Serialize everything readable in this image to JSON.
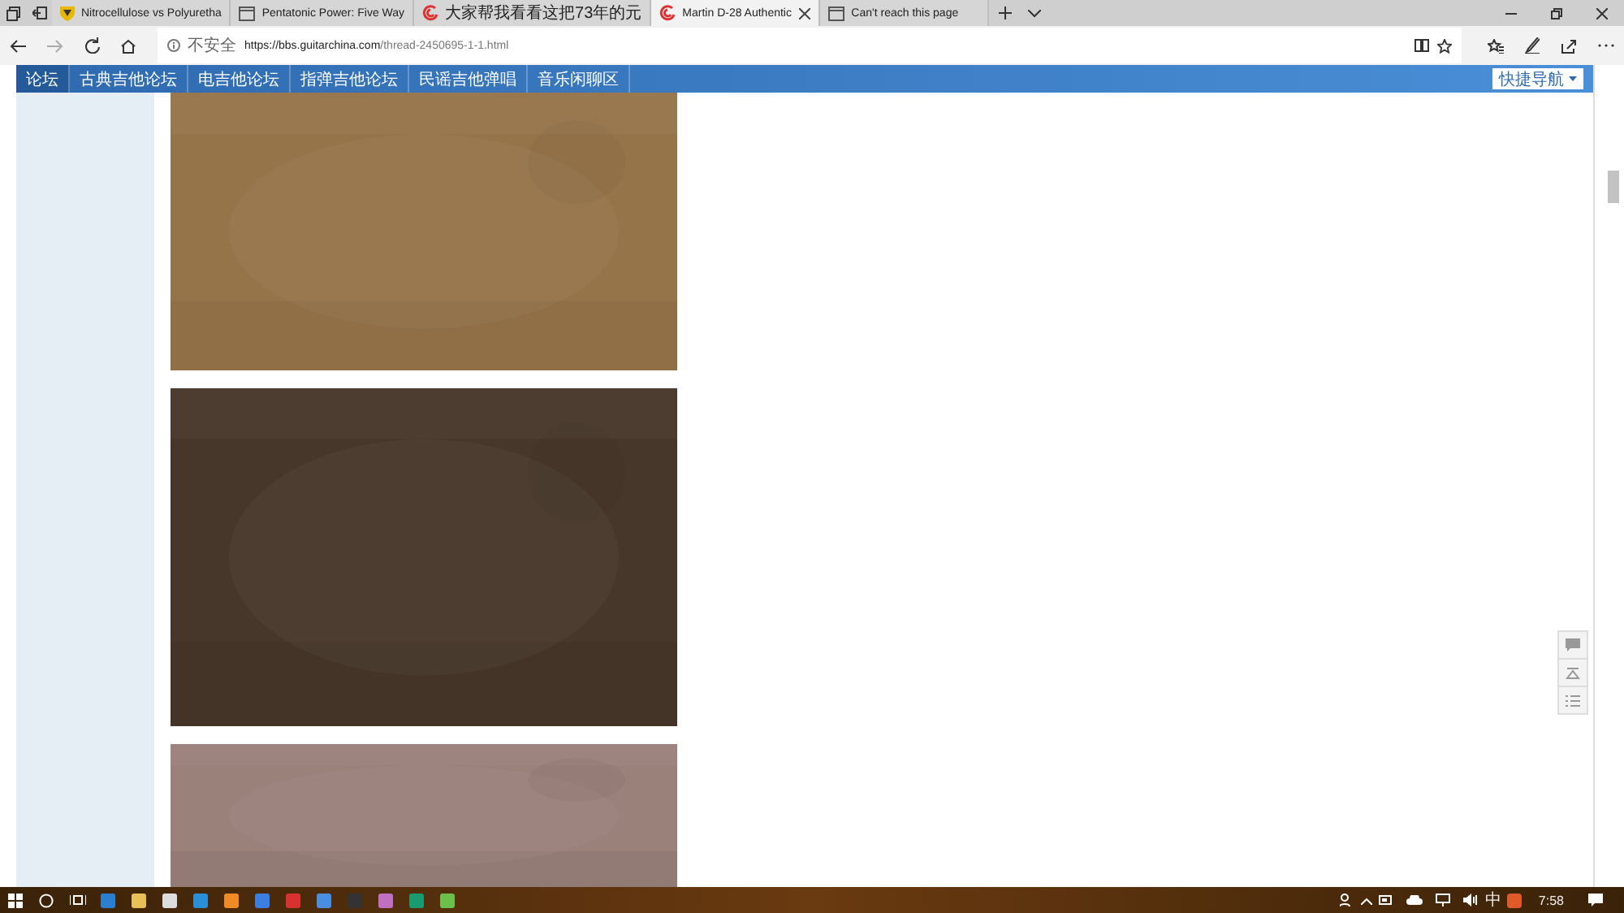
{
  "tabs": [
    {
      "title": "Nitrocellulose vs Polyuretha",
      "kind": "shield",
      "selected": false
    },
    {
      "title": "Pentatonic Power: Five Way",
      "kind": "page",
      "selected": false
    },
    {
      "title": "大家帮我看看这把73年的元",
      "kind": "swirl",
      "selected": false
    },
    {
      "title": "Martin D-28 Authentic",
      "kind": "swirl",
      "selected": true
    },
    {
      "title": "Can't reach this page",
      "kind": "page",
      "selected": false
    }
  ],
  "address_bar": {
    "security": "不安全",
    "host": "https://bbs.guitarchina.com",
    "path": "/thread-2450695-1-1.html"
  },
  "site_nav": {
    "items": [
      {
        "label": "论坛",
        "selected": true
      },
      {
        "label": "古典吉他论坛",
        "selected": false
      },
      {
        "label": "电吉他论坛",
        "selected": false
      },
      {
        "label": "指弹吉他论坛",
        "selected": false
      },
      {
        "label": "民谣吉他弹唱",
        "selected": false
      },
      {
        "label": "音乐闲聊区",
        "selected": false
      }
    ],
    "quick_nav": "快捷导航"
  },
  "taskbar": {
    "ime": "中",
    "clock": "7:58"
  }
}
